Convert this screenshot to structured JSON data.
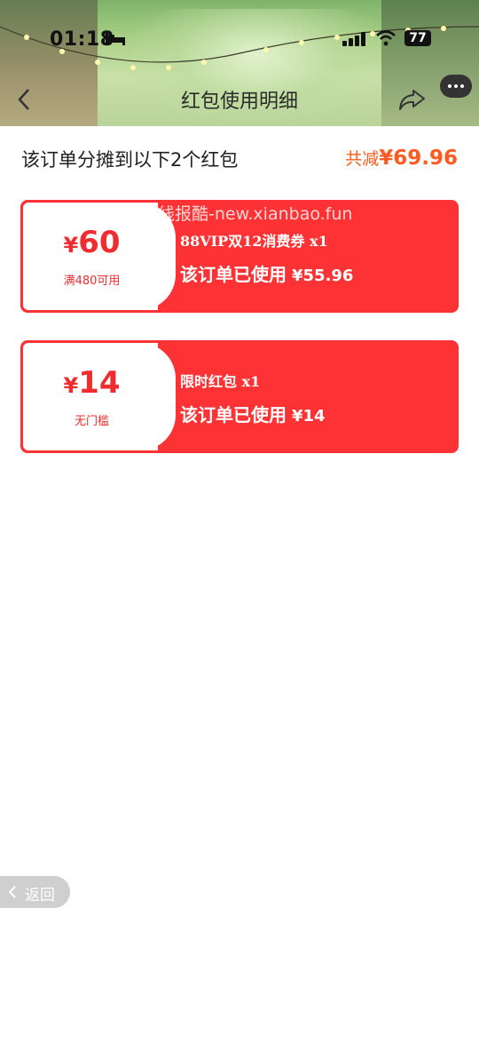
{
  "status_bar": {
    "time": "01:18",
    "battery": "77"
  },
  "nav": {
    "title": "红包使用明细"
  },
  "summary": {
    "text": "该订单分摊到以下2个红包",
    "total_label": "共减",
    "total_amount": "¥69.96"
  },
  "watermark": "线报酷-new.xianbao.fun",
  "coupons": [
    {
      "yen": "¥",
      "amount": "60",
      "condition": "满480可用",
      "name": "88VIP双12消费券 x1",
      "used_label": "该订单已使用",
      "used_value": "¥55.96"
    },
    {
      "yen": "¥",
      "amount": "14",
      "condition": "无门槛",
      "name": "限时红包 x1",
      "used_label": "该订单已使用",
      "used_value": "¥14"
    }
  ],
  "back_button": {
    "label": "返回"
  },
  "colors": {
    "coupon_red": "#fd3235",
    "accent_orange": "#ff5a1f"
  },
  "icons": [
    "bed-icon",
    "signal-icon",
    "wifi-icon",
    "back-arrow-icon",
    "share-icon",
    "more-icon",
    "chevron-left-icon"
  ]
}
